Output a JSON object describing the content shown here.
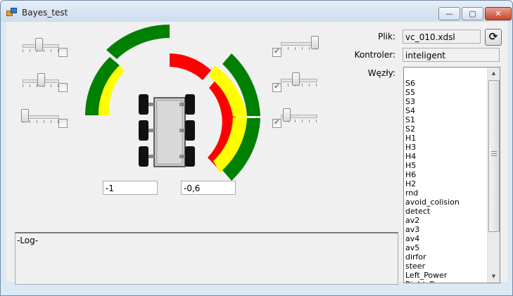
{
  "window": {
    "title": "Bayes_test"
  },
  "controls": {
    "minimize_glyph": "—",
    "maximize_glyph": "▢",
    "close_glyph": "✕",
    "refresh_glyph": "⟳"
  },
  "left_sliders": [
    {
      "value": 0.45,
      "checked": false
    },
    {
      "value": 0.5,
      "checked": false
    },
    {
      "value": 0.0,
      "checked": false
    }
  ],
  "right_sliders": [
    {
      "value": 1.0,
      "checked": true
    },
    {
      "value": 0.4,
      "checked": true
    },
    {
      "value": 0.1,
      "checked": true
    }
  ],
  "gauges": {
    "left_value": "-1",
    "right_value": "-0,6",
    "colors": {
      "green": "#008000",
      "yellow": "#ffff00",
      "red": "#ff0000"
    }
  },
  "form": {
    "plik_label": "Plik:",
    "plik_value": "vc_010.xdsl",
    "kontroler_label": "Kontroler:",
    "kontroler_value": "inteligent",
    "wezly_label": "Węzły:"
  },
  "nodes": [
    "S6",
    "S5",
    "S3",
    "S4",
    "S1",
    "S2",
    "H1",
    "H3",
    "H4",
    "H5",
    "H6",
    "H2",
    "rnd",
    "avoid_colision",
    "detect",
    "av2",
    "av3",
    "av4",
    "av5",
    "dirfor",
    "steer",
    "Left_Power",
    "Right_Power"
  ],
  "log": {
    "text": "-Log-"
  }
}
